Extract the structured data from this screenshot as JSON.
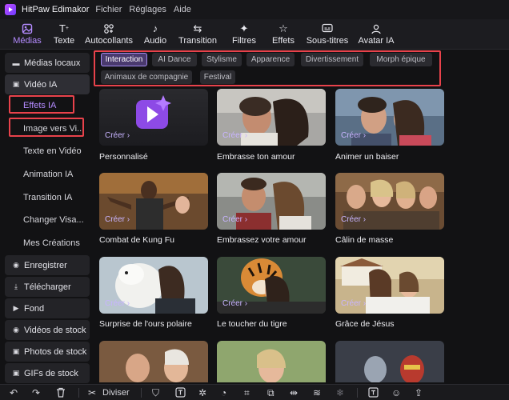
{
  "app": {
    "title": "HitPaw Edimakor",
    "menu": [
      "Fichier",
      "Réglages",
      "Aide"
    ]
  },
  "toolbar": {
    "tools": [
      {
        "label": "Médias",
        "icon": "media-icon",
        "active": true
      },
      {
        "label": "Texte",
        "icon": "text-icon"
      },
      {
        "label": "Autocollants",
        "icon": "stickers-icon"
      },
      {
        "label": "Audio",
        "icon": "audio-icon"
      },
      {
        "label": "Transition",
        "icon": "transition-icon"
      },
      {
        "label": "Filtres",
        "icon": "filters-icon"
      },
      {
        "label": "Effets",
        "icon": "effects-icon"
      },
      {
        "label": "Sous-titres",
        "icon": "subtitles-icon"
      },
      {
        "label": "Avatar IA",
        "icon": "avatar-icon"
      }
    ]
  },
  "sidebar": {
    "items": [
      {
        "label": "Médias locaux",
        "icon": "folder-icon"
      },
      {
        "label": "Vidéo IA",
        "icon": "video-ai-icon",
        "active": true
      },
      {
        "label": "Effets IA",
        "sub": true,
        "active": true
      },
      {
        "label": "Image vers Vi...",
        "sub": true
      },
      {
        "label": "Texte en Vidéo",
        "sub": true
      },
      {
        "label": "Animation IA",
        "sub": true
      },
      {
        "label": "Transition IA",
        "sub": true
      },
      {
        "label": "Changer Visa...",
        "sub": true
      },
      {
        "label": "Mes Créations",
        "sub": true
      },
      {
        "label": "Enregistrer",
        "icon": "record-icon"
      },
      {
        "label": "Télécharger",
        "icon": "download-icon"
      },
      {
        "label": "Fond",
        "icon": "background-icon"
      },
      {
        "label": "Vidéos de stock",
        "icon": "stock-video-icon"
      },
      {
        "label": "Photos de stock",
        "icon": "stock-photo-icon"
      },
      {
        "label": "GIFs de stock",
        "icon": "stock-gif-icon"
      }
    ]
  },
  "filters": {
    "chips": [
      "Interaction",
      "AI Dance",
      "Stylisme",
      "Apparence",
      "Divertissement",
      "Morph épique",
      "Animaux de compagnie",
      "Festival"
    ],
    "active": "Interaction"
  },
  "cards": [
    {
      "label": "Personnalisé",
      "cta": "Créer"
    },
    {
      "label": "Embrasse ton amour",
      "cta": "Créer"
    },
    {
      "label": "Animer un baiser",
      "cta": "Créer"
    },
    {
      "label": "Combat de Kung Fu",
      "cta": "Créer"
    },
    {
      "label": "Embrassez votre amour",
      "cta": "Créer"
    },
    {
      "label": "Câlin de masse",
      "cta": "Créer"
    },
    {
      "label": "Surprise de l'ours polaire",
      "cta": "Créer"
    },
    {
      "label": "Le toucher du tigre",
      "cta": "Créer"
    },
    {
      "label": "Grâce de Jésus",
      "cta": "Créer"
    },
    {
      "label": "",
      "cta": ""
    },
    {
      "label": "",
      "cta": ""
    },
    {
      "label": "",
      "cta": ""
    }
  ],
  "bottombar": {
    "split_label": "Diviser",
    "icons": [
      "undo-icon",
      "redo-icon",
      "delete-icon",
      "scissors-icon",
      "shield-icon",
      "text-box-icon",
      "speed-icon",
      "gauge-icon",
      "crop-icon",
      "resize-icon",
      "mirror-icon",
      "adjust-icon",
      "freeze-icon",
      "text-overlay-icon",
      "face-icon",
      "export-icon"
    ]
  },
  "colors": {
    "accent": "#b48bff",
    "highlight_border": "#e8424b",
    "background": "#121214"
  }
}
